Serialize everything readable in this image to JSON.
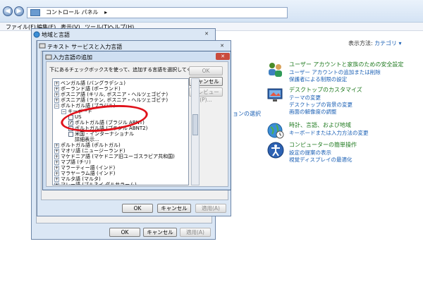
{
  "explorer": {
    "address": "コントロール パネル",
    "menu": [
      "ファイル(F)",
      "編集(E)",
      "表示(V)",
      "ツール(T)",
      "ヘルプ(H)"
    ],
    "view_by_label": "表示方法:",
    "view_by_value": "カテゴリ ▾"
  },
  "control_panel": {
    "groups": [
      {
        "title": "ユーザー アカウントと家族のための安全設定",
        "links": [
          "ユーザー アカウントの追加または削除",
          "保護者による制限の設定"
        ],
        "icon": "users-icon"
      },
      {
        "title": "デスクトップのカスタマイズ",
        "links": [
          "テーマの変更",
          "デスクトップの背景の変更",
          "画面の解像度の調整"
        ],
        "icon": "display-icon"
      },
      {
        "title": "時計、言語、および地域",
        "links": [
          "キーボードまたは入力方法の変更"
        ],
        "icon": "globe-clock-icon"
      },
      {
        "title": "コンピューターの簡単操作",
        "links": [
          "設定の提案の表示",
          "視覚ディスプレイの最適化"
        ],
        "icon": "ease-of-access-icon"
      }
    ],
    "side_link_partial": "ョンの選択"
  },
  "region_dialog": {
    "title": "地域と言語",
    "close": "✕",
    "ok": "OK",
    "cancel": "キャンセル",
    "apply": "適用(A)"
  },
  "text_services_dialog": {
    "title": "テキスト サービスと入力言語",
    "close": "✕",
    "ok": "OK",
    "cancel": "キャンセル",
    "apply": "適用(A)"
  },
  "add_language_dialog": {
    "title": "入力言語の追加",
    "close": "✕",
    "instruction": "下にあるチェックボックスを使って、追加する言語を選択してください:",
    "ok": "OK",
    "cancel": "キャンセル",
    "preview": "プレビュー(P)...",
    "tree": [
      {
        "label": "ベンガル語 (バングラデシュ)",
        "indent": 0,
        "type": "expand",
        "mark": "+"
      },
      {
        "label": "ポーランド語 (ポーランド)",
        "indent": 0,
        "type": "expand",
        "mark": "+"
      },
      {
        "label": "ボスニア語 (キリル, ボスニア・ヘルツェゴビナ)",
        "indent": 0,
        "type": "expand",
        "mark": "+"
      },
      {
        "label": "ボスニア語 (ラテン, ボスニア・ヘルツェゴビナ)",
        "indent": 0,
        "type": "expand",
        "mark": "+"
      },
      {
        "label": "ポルトガル語 (ブラジル)",
        "indent": 0,
        "type": "expand",
        "mark": "−"
      },
      {
        "label": "キーボード",
        "indent": 1,
        "type": "expand",
        "mark": "−"
      },
      {
        "label": "US",
        "indent": 2,
        "type": "checkbox",
        "checked": false
      },
      {
        "label": "ポルトガル語 (ブラジル ABNT)",
        "indent": 2,
        "type": "checkbox",
        "checked": true
      },
      {
        "label": "ポルトガル語 (ブラジル ABNT2)",
        "indent": 2,
        "type": "checkbox",
        "checked": false
      },
      {
        "label": "米国 - インターナショナル",
        "indent": 2,
        "type": "checkbox",
        "checked": false
      },
      {
        "label": "詳細表示...",
        "indent": 2,
        "type": "text"
      },
      {
        "label": "ポルトガル語 (ポルトガル)",
        "indent": 0,
        "type": "expand",
        "mark": "+"
      },
      {
        "label": "マオリ語 (ニュージーランド)",
        "indent": 0,
        "type": "expand",
        "mark": "+"
      },
      {
        "label": "マケドニア語 (マケドニア旧ユーゴスラビア共和国)",
        "indent": 0,
        "type": "expand",
        "mark": "+"
      },
      {
        "label": "マプ語 (チリ)",
        "indent": 0,
        "type": "expand",
        "mark": "+"
      },
      {
        "label": "マラーティー語 (インド)",
        "indent": 0,
        "type": "expand",
        "mark": "+"
      },
      {
        "label": "マラヤーラム語 (インド)",
        "indent": 0,
        "type": "expand",
        "mark": "+"
      },
      {
        "label": "マルタ語 (マルタ)",
        "indent": 0,
        "type": "expand",
        "mark": "+"
      },
      {
        "label": "マレー語 (ブルネイ ダルサラーム)",
        "indent": 0,
        "type": "expand",
        "mark": "+"
      }
    ]
  },
  "colors": {
    "link": "#1a5fb4",
    "category_title": "#1f7a1f",
    "annotation": "#e0121b",
    "dialog_frame": "#dbe7f5"
  }
}
